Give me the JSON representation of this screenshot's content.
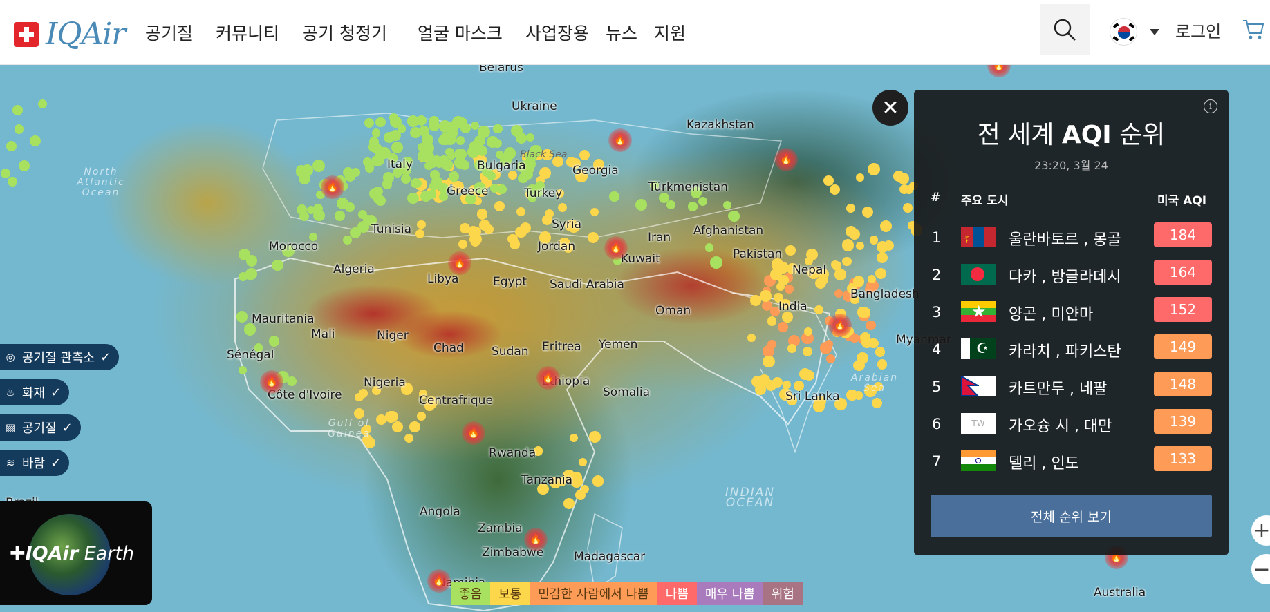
{
  "header": {
    "logo_text": "IQAir",
    "nav": [
      "공기질",
      "커뮤니티",
      "공기 청정기",
      "얼굴 마스크",
      "사업장용",
      "뉴스",
      "지원"
    ],
    "login": "로그인",
    "colors": {
      "brand_red": "#e2262b",
      "brand_blue": "#4a8ab6"
    }
  },
  "map": {
    "countries": [
      {
        "name": "Belarus"
      },
      {
        "name": "Ukraine"
      },
      {
        "name": "Kazakhstan"
      },
      {
        "name": "Georgia"
      },
      {
        "name": "Türkmenistan"
      },
      {
        "name": "Tunisia"
      },
      {
        "name": "Syria"
      },
      {
        "name": "Morocco"
      },
      {
        "name": "Algeria"
      },
      {
        "name": "Libya"
      },
      {
        "name": "Egypt"
      },
      {
        "name": "Jordan"
      },
      {
        "name": "Iran"
      },
      {
        "name": "Afghanistan"
      },
      {
        "name": "Pakistan"
      },
      {
        "name": "Kuwait"
      },
      {
        "name": "Saudi Arabia"
      },
      {
        "name": "Oman"
      },
      {
        "name": "Mauritania"
      },
      {
        "name": "Mali"
      },
      {
        "name": "Niger"
      },
      {
        "name": "Chad"
      },
      {
        "name": "Sudan"
      },
      {
        "name": "Eritrea"
      },
      {
        "name": "Yemen"
      },
      {
        "name": "Sénégal"
      },
      {
        "name": "Nigeria"
      },
      {
        "name": "Ethiopia"
      },
      {
        "name": "Côte d'Ivoire"
      },
      {
        "name": "Centrafrique"
      },
      {
        "name": "Somalia"
      },
      {
        "name": "Rwanda"
      },
      {
        "name": "Tanzania"
      },
      {
        "name": "Angola"
      },
      {
        "name": "Zambia"
      },
      {
        "name": "Zimbabwe"
      },
      {
        "name": "Madagascar"
      },
      {
        "name": "Namibia"
      },
      {
        "name": "India"
      },
      {
        "name": "Bangladesh"
      },
      {
        "name": "Myanmar"
      },
      {
        "name": "Sri Lanka"
      },
      {
        "name": "Nepal"
      },
      {
        "name": "Australia"
      },
      {
        "name": "Greece"
      },
      {
        "name": "Turkey"
      },
      {
        "name": "Italy"
      },
      {
        "name": "Bulgaria"
      },
      {
        "name": "Black Sea"
      },
      {
        "name": "Brazil"
      }
    ],
    "oceans": [
      {
        "name": "North Atlantic Ocean"
      },
      {
        "name": "Gulf of Guinea"
      },
      {
        "name": "INDIAN OCEAN"
      },
      {
        "name": "Arabian Sea"
      }
    ]
  },
  "layers": [
    {
      "label": "공기질 관측소",
      "icon": "location-pin-icon"
    },
    {
      "label": "화재",
      "icon": "fire-icon"
    },
    {
      "label": "공기질",
      "icon": "air-quality-icon"
    },
    {
      "label": "바람",
      "icon": "wind-icon"
    }
  ],
  "earth_badge": {
    "brand": "IQAir",
    "product": "Earth"
  },
  "legend": [
    {
      "label": "좋음",
      "color": "#a8e05f"
    },
    {
      "label": "보통",
      "color": "#fdd74b"
    },
    {
      "label": "민감한 사람에서 나쁨",
      "color": "#fe9b57"
    },
    {
      "label": "나쁨",
      "color": "#fe6a69"
    },
    {
      "label": "매우 나쁨",
      "color": "#a97abc"
    },
    {
      "label": "위험",
      "color": "#a87383"
    }
  ],
  "ranking": {
    "title_prefix": "전 세계",
    "title_bold": "AQI",
    "title_suffix": "순위",
    "time": "23:20, 3월 24",
    "col_rank": "#",
    "col_city": "주요 도시",
    "col_aqi": "미국 AQI",
    "rows": [
      {
        "rank": "1",
        "city": "울란바토르 , 몽골",
        "aqi": "184",
        "color": "#fe6a69",
        "flag": "mongolia-flag-icon"
      },
      {
        "rank": "2",
        "city": "다카 , 방글라데시",
        "aqi": "164",
        "color": "#fe6a69",
        "flag": "bangladesh-flag-icon"
      },
      {
        "rank": "3",
        "city": "양곤 , 미얀마",
        "aqi": "152",
        "color": "#fe6a69",
        "flag": "myanmar-flag-icon"
      },
      {
        "rank": "4",
        "city": "카라치 , 파키스탄",
        "aqi": "149",
        "color": "#fe9b57",
        "flag": "pakistan-flag-icon"
      },
      {
        "rank": "5",
        "city": "카트만두 , 네팔",
        "aqi": "148",
        "color": "#fe9b57",
        "flag": "nepal-flag-icon"
      },
      {
        "rank": "6",
        "city": "가오슝 시 , 대만",
        "aqi": "139",
        "color": "#fe9b57",
        "flag": "taiwan-flag-icon",
        "flag_text": "TW"
      },
      {
        "rank": "7",
        "city": "델리 , 인도",
        "aqi": "133",
        "color": "#fe9b57",
        "flag": "india-flag-icon"
      }
    ],
    "button": "전체 순위 보기"
  }
}
